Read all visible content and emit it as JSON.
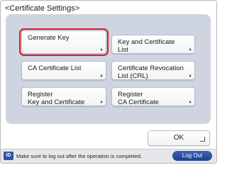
{
  "screen": {
    "title": "<Certificate Settings>"
  },
  "buttons": [
    {
      "label": "Generate Key"
    },
    {
      "label": "Key and Certificate\nList"
    },
    {
      "label": "CA Certificate List"
    },
    {
      "label": "Certificate Revocation\nList (CRL)"
    },
    {
      "label": "Register\nKey and Certificate"
    },
    {
      "label": "Register\nCA Certificate"
    }
  ],
  "ok": {
    "label": "OK"
  },
  "footer": {
    "id_badge": "ID",
    "notice": "Make sure to log out after the operation is completed.",
    "logout_label": "Log Out"
  },
  "colors": {
    "selection": "#e01818",
    "panel": "#cfd4e1",
    "logout": "#2a4c9e"
  }
}
